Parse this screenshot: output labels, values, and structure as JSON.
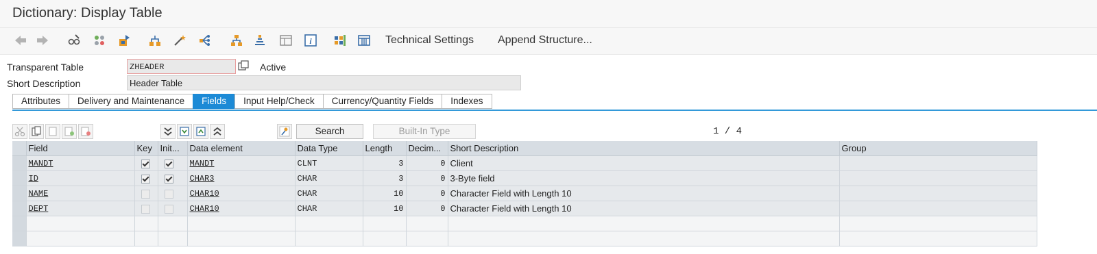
{
  "title": "Dictionary: Display Table",
  "toolbar": {
    "icons": [
      "back-arrow-icon",
      "forward-arrow-icon",
      "glasses-edit-icon",
      "other-object-icon",
      "activate-icon",
      "where-used-icon",
      "magic-wand-icon",
      "object-list-icon",
      "hierarchy-icon",
      "navigation-window-icon",
      "layout-icon",
      "information-icon",
      "grid-icon",
      "table-columns-icon"
    ],
    "technical_settings": "Technical Settings",
    "append_structure": "Append Structure..."
  },
  "header": {
    "table_label": "Transparent Table",
    "table_value": "ZHEADER",
    "status": "Active",
    "short_desc_label": "Short Description",
    "short_desc_value": "Header Table"
  },
  "tabs": [
    {
      "label": "Attributes",
      "active": false
    },
    {
      "label": "Delivery and Maintenance",
      "active": false
    },
    {
      "label": "Fields",
      "active": true
    },
    {
      "label": "Input Help/Check",
      "active": false
    },
    {
      "label": "Currency/Quantity Fields",
      "active": false
    },
    {
      "label": "Indexes",
      "active": false
    }
  ],
  "grid_toolbar": {
    "search": "Search",
    "builtin": "Built-In Type",
    "pager": "1 / 4"
  },
  "grid": {
    "columns": [
      "Field",
      "Key",
      "Init...",
      "Data element",
      "Data Type",
      "Length",
      "Decim...",
      "Short Description",
      "Group"
    ],
    "rows": [
      {
        "field": "MANDT",
        "key": true,
        "init": true,
        "data_element": "MANDT",
        "data_type": "CLNT",
        "length": "3",
        "decimals": "0",
        "desc": "Client",
        "group": ""
      },
      {
        "field": "ID",
        "key": true,
        "init": true,
        "data_element": "CHAR3",
        "data_type": "CHAR",
        "length": "3",
        "decimals": "0",
        "desc": "3-Byte field",
        "group": ""
      },
      {
        "field": "NAME",
        "key": false,
        "init": false,
        "data_element": "CHAR10",
        "data_type": "CHAR",
        "length": "10",
        "decimals": "0",
        "desc": "Character Field with Length 10",
        "group": ""
      },
      {
        "field": "DEPT",
        "key": false,
        "init": false,
        "data_element": "CHAR10",
        "data_type": "CHAR",
        "length": "10",
        "decimals": "0",
        "desc": "Character Field with Length 10",
        "group": ""
      }
    ],
    "empty_rows": 2
  }
}
